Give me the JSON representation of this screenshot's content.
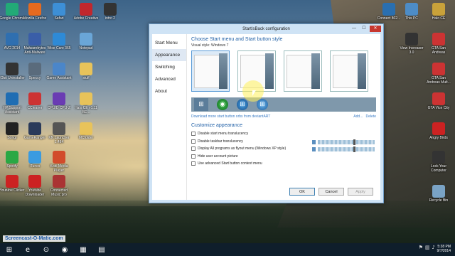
{
  "window": {
    "title": "StartIsBack configuration",
    "nav": [
      "Start Menu",
      "Appearance",
      "Switching",
      "Advanced",
      "About"
    ],
    "heading": "Choose Start menu and Start button style",
    "visual_style_label": "Visual style:",
    "visual_style_value": "Windows 7",
    "download_link": "Download more start button orbs from deviantART",
    "add_label": "Add...",
    "delete_label": "Delete",
    "customize_heading": "Customize appearance",
    "options": [
      "Disable start menu translucency",
      "Disable taskbar translucency",
      "Display All programs as flyout menu (Windows XP style)",
      "Hide user account picture",
      "Use advanced Start button context menu"
    ],
    "ok": "OK",
    "cancel": "Cancel",
    "apply": "Apply",
    "slider1_level": 0.63,
    "slider2_level": 0.63
  },
  "desktop_left": [
    {
      "label": "Google Chrome",
      "color": "#2a7"
    },
    {
      "label": "Mozilla Firefox",
      "color": "#e66a1f"
    },
    {
      "label": "Safari",
      "color": "#3d8fd6"
    },
    {
      "label": "Adobe Creative",
      "color": "#c1272d"
    },
    {
      "label": "intro 2",
      "color": "#333"
    },
    {
      "label": "AVG 2014",
      "color": "#2f6fb0"
    },
    {
      "label": "Malwarebytes Anti-Malware",
      "color": "#3a5ea8"
    },
    {
      "label": "Wise Care 365",
      "color": "#2e8ad6"
    },
    {
      "label": "Notepad",
      "color": "#6aa6d8"
    },
    {
      "label": "IObit Uninstaller",
      "color": "#333"
    },
    {
      "label": "Speccy",
      "color": "#5a6b7c"
    },
    {
      "label": "Game Assistant",
      "color": "#4b86c9"
    },
    {
      "label": "stuff",
      "color": "#e8c35a"
    },
    {
      "label": "HP Support Assistant",
      "color": "#1f6db3"
    },
    {
      "label": "CCleaner",
      "color": "#c33"
    },
    {
      "label": "CPUID CPU-Z",
      "color": "#6a3cb3"
    },
    {
      "label": "Halo CE v1.11 BE...",
      "color": "#e8c35a"
    },
    {
      "label": "Songr",
      "color": "#222"
    },
    {
      "label": "GameRanger",
      "color": "#2a3a5a"
    },
    {
      "label": "KN Launcher 1.484",
      "color": "#555"
    },
    {
      "label": "MCfolder",
      "color": "#e8c35a"
    },
    {
      "label": "Spotify",
      "color": "#2aa844"
    },
    {
      "label": "iTunes",
      "color": "#3a9be0"
    },
    {
      "label": "Kodi Media Player",
      "color": "#d24b2b"
    },
    {
      "label": "Youtube Clicker",
      "color": "#c22"
    },
    {
      "label": "Youtube Downloader",
      "color": "#c22"
    },
    {
      "label": "Connected Music pro",
      "color": "#a33"
    }
  ],
  "desktop_right": [
    {
      "label": "Connect 802...",
      "color": "#2a6fb0"
    },
    {
      "label": "This PC",
      "color": "#4d8cc6"
    },
    {
      "label": "Halo CE",
      "color": "#c9a23a"
    },
    {
      "label": "View Increaser 3.0",
      "color": "#333"
    },
    {
      "label": "GTA San Andreas",
      "color": "#c33"
    },
    {
      "label": "GTA San Andreas Mult...",
      "color": "#c33"
    },
    {
      "label": "GTA Vice City",
      "color": "#c33"
    },
    {
      "label": "Angry Birds",
      "color": "#c22"
    },
    {
      "label": "Lock Your Computer",
      "color": "#333"
    },
    {
      "label": "Recycle Bin",
      "color": "#7aa3c5"
    }
  ],
  "watermark": "Screencast-O-Matic.com",
  "taskbar": {
    "time": "5:38 PM",
    "date": "9/7/2014",
    "icons": [
      "⊞",
      "e",
      "⊙",
      "◉",
      "▦",
      "▤"
    ],
    "icon_names": [
      "start-icon",
      "ie-icon",
      "chrome-icon",
      "firefox-icon",
      "explorer-icon",
      "app-icon"
    ]
  }
}
